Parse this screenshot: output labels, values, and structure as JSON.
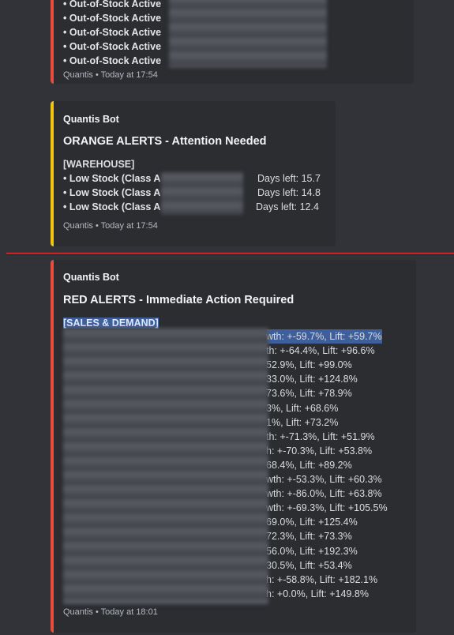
{
  "top_embed": {
    "lines": [
      "• Out-of-Stock Active",
      "• Out-of-Stock Active",
      "• Out-of-Stock Active",
      "• Out-of-Stock Active",
      "• Out-of-Stock Active"
    ],
    "footer": "Quantis • Today at 17:54",
    "accent_color": "#e74c3c"
  },
  "orange_embed": {
    "author": "Quantis Bot",
    "title": "ORANGE ALERTS - Attention Needed",
    "section": "[WAREHOUSE]",
    "lines": [
      {
        "label": "• Low Stock (Class A",
        "tail": "Days left: 15.7"
      },
      {
        "label": "• Low Stock (Class A",
        "tail": "Days left: 14.8"
      },
      {
        "label": "• Low Stock (Class A",
        "tail": "Days left: 12.4"
      }
    ],
    "footer": "Quantis • Today at 17:54",
    "accent_color": "#f1c40f"
  },
  "new_messages_divider_color": "#f23f42",
  "red_embed": {
    "author": "Quantis Bot",
    "title": "RED ALERTS - Immediate Action Required",
    "section": "[SALES & DEMAND]",
    "lines": [
      "wth: +-59.7%, Lift: +59.7%",
      "th: +-64.4%, Lift: +96.6%",
      "52.9%, Lift: +99.0%",
      "33.0%, Lift: +124.8%",
      "73.6%, Lift: +78.9%",
      "3%, Lift: +68.6%",
      "1%, Lift: +73.2%",
      "th: +-71.3%, Lift: +51.9%",
      "h: +-70.3%, Lift: +53.8%",
      "68.4%, Lift: +89.2%",
      "wth: +-53.3%, Lift: +60.3%",
      "wth: +-86.0%, Lift: +63.8%",
      "wth: +-69.3%, Lift: +105.5%",
      "69.0%, Lift: +125.4%",
      "72.3%, Lift: +73.3%",
      "56.0%, Lift: +192.3%",
      "30.5%, Lift: +53.4%",
      "h: +-58.8%, Lift: +182.1%",
      "h: +0.0%, Lift: +149.8%"
    ],
    "footer": "Quantis • Today at 18:01",
    "accent_color": "#e74c3c"
  }
}
